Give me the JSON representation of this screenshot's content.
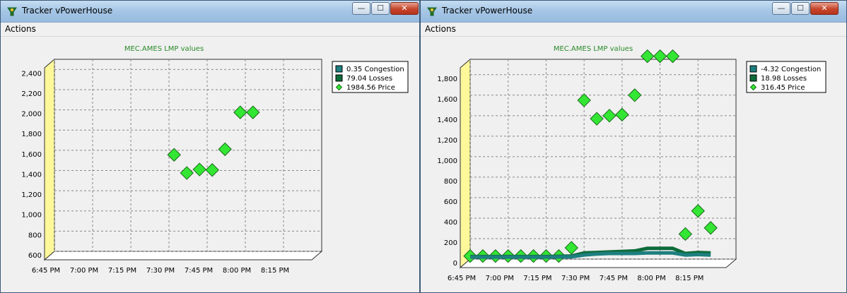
{
  "windows": [
    {
      "title": "Tracker vPowerHouse",
      "menu": [
        "Actions"
      ],
      "chart_data": {
        "type": "scatter",
        "title": "MEC.AMES LMP values",
        "x": [
          "6:45 PM",
          "7:00 PM",
          "7:15 PM",
          "7:30 PM",
          "7:45 PM",
          "8:00 PM",
          "8:15 PM"
        ],
        "xlim_minutes": [
          0,
          105
        ],
        "yticks": [
          "600",
          "800",
          "1,000",
          "1,200",
          "1,400",
          "1,600",
          "1,800",
          "2,000",
          "2,200",
          "2,400"
        ],
        "ylim": [
          600,
          2500
        ],
        "legend_placement": "top-right",
        "grid": true,
        "legend": [
          {
            "value": "0.35",
            "name": "Congestion",
            "color": "#1e7f7f",
            "marker": "square"
          },
          {
            "value": "79.04",
            "name": "Losses",
            "color": "#0e6b3a",
            "marker": "square"
          },
          {
            "value": "1984.56",
            "name": "Price",
            "color": "#33e633",
            "marker": "diamond"
          }
        ],
        "series": [
          {
            "name": "Price",
            "color": "#33e633",
            "points": [
              [
                47,
                1555
              ],
              [
                52,
                1375
              ],
              [
                57,
                1410
              ],
              [
                62,
                1405
              ],
              [
                67,
                1610
              ],
              [
                73,
                1975
              ],
              [
                78,
                1975
              ]
            ]
          }
        ]
      }
    },
    {
      "title": "Tracker vPowerHouse",
      "menu": [
        "Actions"
      ],
      "chart_data": {
        "type": "scatter",
        "title": "MEC.AMES LMP values",
        "x": [
          "6:45 PM",
          "7:00 PM",
          "7:15 PM",
          "7:30 PM",
          "7:45 PM",
          "8:00 PM",
          "8:15 PM"
        ],
        "xlim_minutes": [
          0,
          105
        ],
        "yticks": [
          "0",
          "200",
          "400",
          "600",
          "800",
          "1,000",
          "1,200",
          "1,400",
          "1,600",
          "1,800"
        ],
        "ylim": [
          0,
          1950
        ],
        "legend_placement": "top-right",
        "grid": true,
        "legend": [
          {
            "value": "-4.32",
            "name": "Congestion",
            "color": "#1e7f7f",
            "marker": "square"
          },
          {
            "value": "18.98",
            "name": "Losses",
            "color": "#0e6b3a",
            "marker": "square"
          },
          {
            "value": "316.45",
            "name": "Price",
            "color": "#33e633",
            "marker": "diamond"
          }
        ],
        "series": [
          {
            "name": "Price",
            "color": "#33e633",
            "points": [
              [
                0,
                30
              ],
              [
                5,
                30
              ],
              [
                10,
                30
              ],
              [
                15,
                30
              ],
              [
                20,
                30
              ],
              [
                25,
                30
              ],
              [
                30,
                30
              ],
              [
                35,
                30
              ],
              [
                40,
                110
              ],
              [
                45,
                1550
              ],
              [
                50,
                1370
              ],
              [
                55,
                1400
              ],
              [
                60,
                1410
              ],
              [
                65,
                1600
              ],
              [
                70,
                1980
              ],
              [
                75,
                1980
              ],
              [
                80,
                1980
              ],
              [
                85,
                245
              ],
              [
                90,
                470
              ],
              [
                95,
                305
              ]
            ]
          },
          {
            "name": "Losses",
            "color": "#0e6b3a",
            "points": [
              [
                0,
                25
              ],
              [
                10,
                25
              ],
              [
                20,
                25
              ],
              [
                30,
                25
              ],
              [
                40,
                30
              ],
              [
                45,
                60
              ],
              [
                50,
                65
              ],
              [
                55,
                70
              ],
              [
                60,
                75
              ],
              [
                65,
                80
              ],
              [
                70,
                105
              ],
              [
                80,
                105
              ],
              [
                85,
                55
              ],
              [
                90,
                65
              ],
              [
                95,
                60
              ]
            ]
          },
          {
            "name": "Congestion",
            "color": "#1e7f7f",
            "points": [
              [
                0,
                20
              ],
              [
                10,
                20
              ],
              [
                20,
                20
              ],
              [
                30,
                20
              ],
              [
                40,
                22
              ],
              [
                45,
                40
              ],
              [
                50,
                50
              ],
              [
                55,
                55
              ],
              [
                60,
                55
              ],
              [
                65,
                55
              ],
              [
                70,
                60
              ],
              [
                80,
                60
              ],
              [
                85,
                40
              ],
              [
                90,
                45
              ],
              [
                95,
                40
              ]
            ]
          }
        ]
      }
    }
  ]
}
